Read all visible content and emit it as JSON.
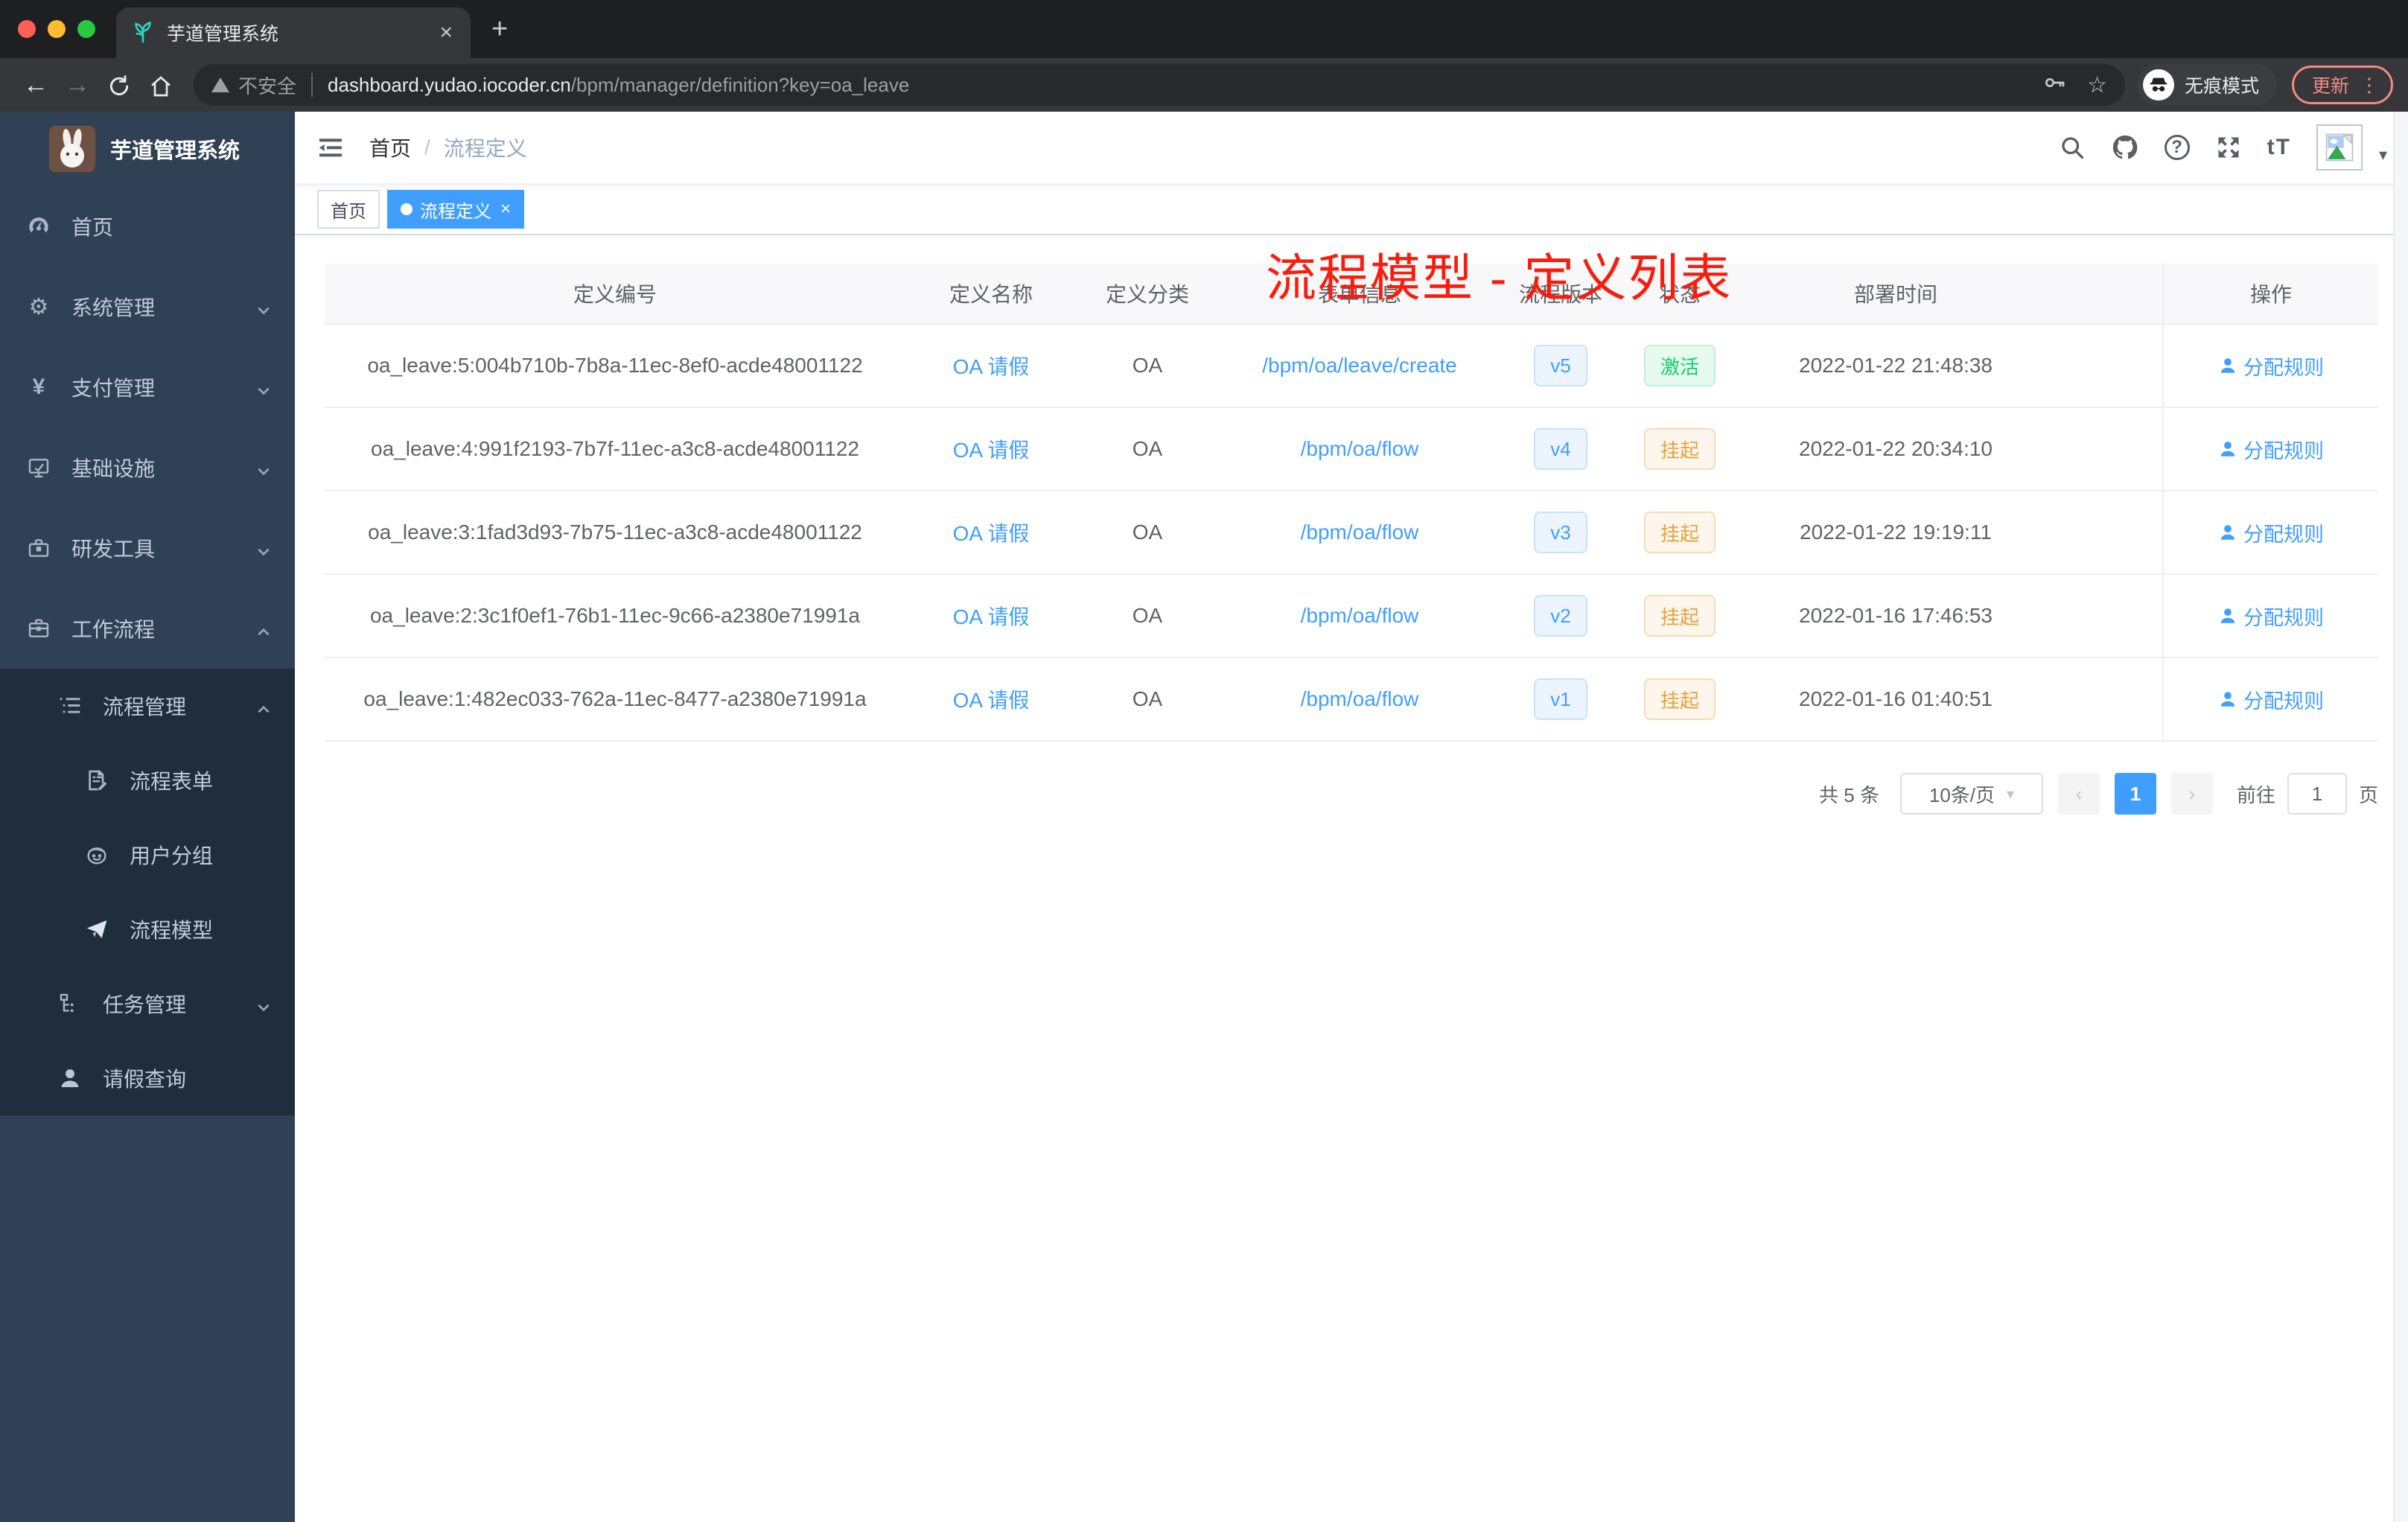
{
  "browser": {
    "tab_title": "芋道管理系统",
    "security_label": "不安全",
    "url_domain": "dashboard.yudao.iocoder.cn",
    "url_path": "/bpm/manager/definition?key=oa_leave",
    "incognito_label": "无痕模式",
    "update_label": "更新"
  },
  "glyphs": {
    "back": "←",
    "forward": "→",
    "tab_close": "×",
    "new_tab": "+",
    "star": "☆",
    "menu_dots": "⋮",
    "caret_down": "▾",
    "gear": "⚙",
    "yen": "¥",
    "question": "?",
    "font_size": "tT",
    "breadcrumb_sep": "/",
    "prev": "‹",
    "next": "›",
    "tag_close": "×",
    "select_caret": "▾"
  },
  "sidebar": {
    "app_title": "芋道管理系统",
    "items": [
      {
        "label": "首页",
        "icon": "dashboard-icon"
      },
      {
        "label": "系统管理",
        "icon": "gear-icon"
      },
      {
        "label": "支付管理",
        "icon": "yen-icon"
      },
      {
        "label": "基础设施",
        "icon": "monitor-icon"
      },
      {
        "label": "研发工具",
        "icon": "toolbox-icon"
      },
      {
        "label": "工作流程",
        "icon": "briefcase-icon"
      }
    ],
    "workflow_submenu": [
      {
        "label": "流程管理",
        "icon": "list-tree-icon"
      },
      {
        "label": "流程表单",
        "icon": "form-edit-icon"
      },
      {
        "label": "用户分组",
        "icon": "face-icon"
      },
      {
        "label": "流程模型",
        "icon": "paper-plane-icon"
      },
      {
        "label": "任务管理",
        "icon": "org-tree-icon"
      },
      {
        "label": "请假查询",
        "icon": "person-icon"
      }
    ]
  },
  "header": {
    "breadcrumb": {
      "home": "首页",
      "current": "流程定义"
    }
  },
  "annotation": {
    "text": "流程模型 - 定义列表"
  },
  "tags": {
    "home": "首页",
    "active": "流程定义"
  },
  "table": {
    "headers": [
      "定义编号",
      "定义名称",
      "定义分类",
      "表单信息",
      "流程版本",
      "状态",
      "部署时间",
      "操作"
    ],
    "action_label": "分配规则",
    "rows": [
      {
        "id": "oa_leave:5:004b710b-7b8a-11ec-8ef0-acde48001122",
        "name": "OA 请假",
        "category": "OA",
        "form": "/bpm/oa/leave/create",
        "version": "v5",
        "status": "激活",
        "status_type": "success",
        "time": "2022-01-22 21:48:38",
        "action": "分配规则"
      },
      {
        "id": "oa_leave:4:991f2193-7b7f-11ec-a3c8-acde48001122",
        "name": "OA 请假",
        "category": "OA",
        "form": "/bpm/oa/flow",
        "version": "v4",
        "status": "挂起",
        "status_type": "warning",
        "time": "2022-01-22 20:34:10",
        "action": "分配规则"
      },
      {
        "id": "oa_leave:3:1fad3d93-7b75-11ec-a3c8-acde48001122",
        "name": "OA 请假",
        "category": "OA",
        "form": "/bpm/oa/flow",
        "version": "v3",
        "status": "挂起",
        "status_type": "warning",
        "time": "2022-01-22 19:19:11",
        "action": "分配规则"
      },
      {
        "id": "oa_leave:2:3c1f0ef1-76b1-11ec-9c66-a2380e71991a",
        "name": "OA 请假",
        "category": "OA",
        "form": "/bpm/oa/flow",
        "version": "v2",
        "status": "挂起",
        "status_type": "warning",
        "time": "2022-01-16 17:46:53",
        "action": "分配规则"
      },
      {
        "id": "oa_leave:1:482ec033-762a-11ec-8477-a2380e71991a",
        "name": "OA 请假",
        "category": "OA",
        "form": "/bpm/oa/flow",
        "version": "v1",
        "status": "挂起",
        "status_type": "warning",
        "time": "2022-01-16 01:40:51",
        "action": "分配规则"
      }
    ]
  },
  "pagination": {
    "total": "共 5 条",
    "page_size": "10条/页",
    "current_page": "1",
    "goto_label": "前往",
    "goto_value": "1",
    "page_unit": "页"
  },
  "colors": {
    "accent": "#409eff",
    "success": "#13ce66",
    "warning": "#e6a23c",
    "annotation_red": "#f81d0d",
    "sidebar_bg": "#304156",
    "submenu_bg": "#1f2d3d"
  }
}
